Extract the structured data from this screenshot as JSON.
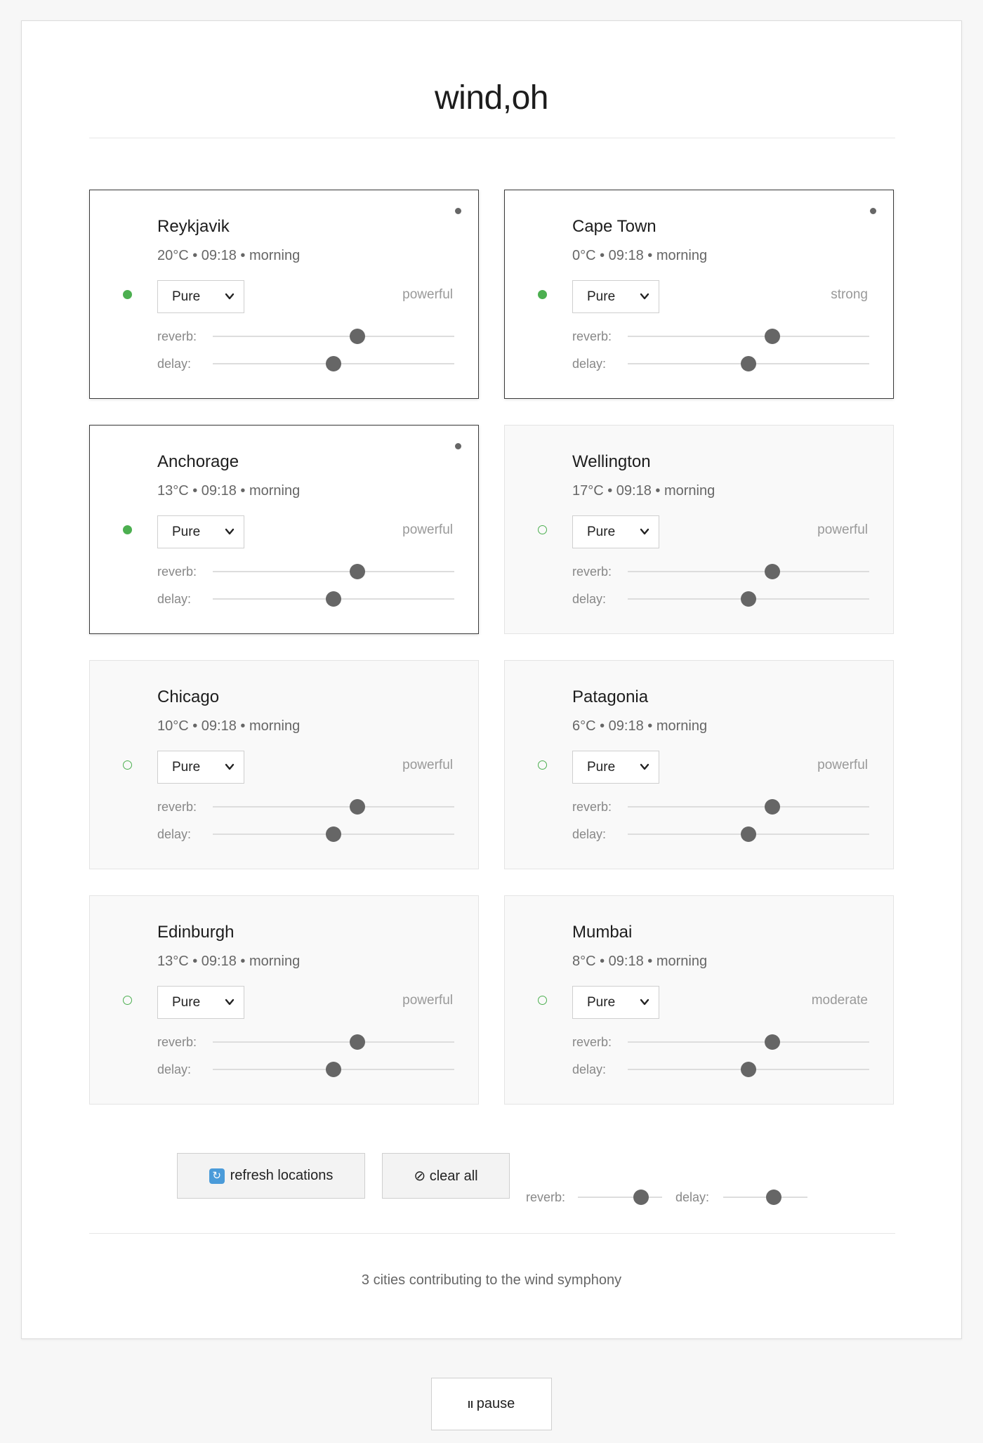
{
  "app": {
    "title": "wind,oh"
  },
  "cards": [
    {
      "city": "Reykjavik",
      "meta": "20°C • 09:18 • morning",
      "preset": "Pure",
      "strength": "powerful",
      "active": true,
      "reverb": 0.6,
      "delay": 0.5
    },
    {
      "city": "Cape Town",
      "meta": "0°C • 09:18 • morning",
      "preset": "Pure",
      "strength": "strong",
      "active": true,
      "reverb": 0.6,
      "delay": 0.5
    },
    {
      "city": "Anchorage",
      "meta": "13°C • 09:18 • morning",
      "preset": "Pure",
      "strength": "powerful",
      "active": true,
      "reverb": 0.6,
      "delay": 0.5
    },
    {
      "city": "Wellington",
      "meta": "17°C • 09:18 • morning",
      "preset": "Pure",
      "strength": "powerful",
      "active": false,
      "reverb": 0.6,
      "delay": 0.5
    },
    {
      "city": "Chicago",
      "meta": "10°C • 09:18 • morning",
      "preset": "Pure",
      "strength": "powerful",
      "active": false,
      "reverb": 0.6,
      "delay": 0.5
    },
    {
      "city": "Patagonia",
      "meta": "6°C • 09:18 • morning",
      "preset": "Pure",
      "strength": "powerful",
      "active": false,
      "reverb": 0.6,
      "delay": 0.5
    },
    {
      "city": "Edinburgh",
      "meta": "13°C • 09:18 • morning",
      "preset": "Pure",
      "strength": "powerful",
      "active": false,
      "reverb": 0.6,
      "delay": 0.5
    },
    {
      "city": "Mumbai",
      "meta": "8°C • 09:18 • morning",
      "preset": "Pure",
      "strength": "moderate",
      "active": false,
      "reverb": 0.6,
      "delay": 0.5
    }
  ],
  "labels": {
    "reverb": "reverb:",
    "delay": "delay:"
  },
  "controls": {
    "refresh_label": "refresh locations",
    "clear_label": "⊘ clear all",
    "reverb_label": "reverb:",
    "delay_label": "delay:",
    "reverb": 0.75,
    "delay": 0.6
  },
  "footer": {
    "status": "3 cities contributing to the wind symphony"
  },
  "pause": {
    "label": "pause"
  },
  "colors": {
    "active_green": "#4caf50",
    "thumb": "#666666"
  }
}
